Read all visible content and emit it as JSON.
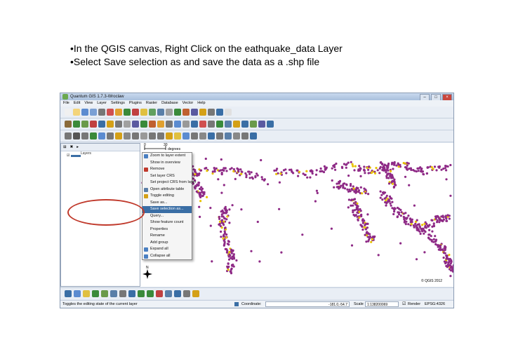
{
  "instructions": [
    "•In the QGIS canvas, Right Click on the eathquake_data Layer",
    "•Select Save selection as and save the data as a .shp file"
  ],
  "window": {
    "title": "Quantum GIS 1.7.3-Wroclaw"
  },
  "menu": [
    "File",
    "Edit",
    "View",
    "Layer",
    "Settings",
    "Plugins",
    "Raster",
    "Database",
    "Vector",
    "Help"
  ],
  "layers_panel": {
    "title": "Layers"
  },
  "context_menu": {
    "items": [
      {
        "label": "Zoom to layer extent",
        "icon": "zoom-extent-icon",
        "color": "#4a7fc1"
      },
      {
        "label": "Show in overview",
        "icon": "",
        "color": ""
      },
      {
        "label": "Remove",
        "icon": "remove-icon",
        "color": "#c0392b"
      },
      {
        "label": "Set layer CRS",
        "icon": "",
        "color": ""
      },
      {
        "label": "Set project CRS from layer",
        "icon": "",
        "color": ""
      },
      {
        "label": "Open attribute table",
        "icon": "table-icon",
        "color": "#5a7fa8"
      },
      {
        "label": "Toggle editing",
        "icon": "pencil-icon",
        "color": "#d4a017"
      },
      {
        "label": "Save as...",
        "icon": "",
        "color": ""
      },
      {
        "label": "Save selection as...",
        "icon": "",
        "color": ""
      },
      {
        "label": "Query...",
        "icon": "",
        "color": ""
      },
      {
        "label": "Show feature count",
        "icon": "",
        "color": ""
      },
      {
        "label": "Properties",
        "icon": "",
        "color": ""
      },
      {
        "label": "Rename",
        "icon": "",
        "color": ""
      },
      {
        "label": "Add group",
        "icon": "",
        "color": ""
      },
      {
        "label": "Expand all",
        "icon": "expand-icon",
        "color": "#4a7fc1"
      },
      {
        "label": "Collapse all",
        "icon": "collapse-icon",
        "color": "#4a7fc1"
      }
    ],
    "selected_index": 8
  },
  "map": {
    "scalebar": {
      "zero": "0",
      "tick": "30",
      "unit": "degrees"
    },
    "north_label": "N",
    "copyright": "© QGIS 2012",
    "point_color": "#8e2a86",
    "highlight_color": "#e8c200"
  },
  "status": {
    "message": "Toggles the editing state of the current layer",
    "coordinate_label": "Coordinate:",
    "coordinate_value": "-181.0,-54.7",
    "scale_label": "Scale",
    "scale_value": "1:138200069",
    "render_label": "Render",
    "crs": "EPSG:4326"
  }
}
